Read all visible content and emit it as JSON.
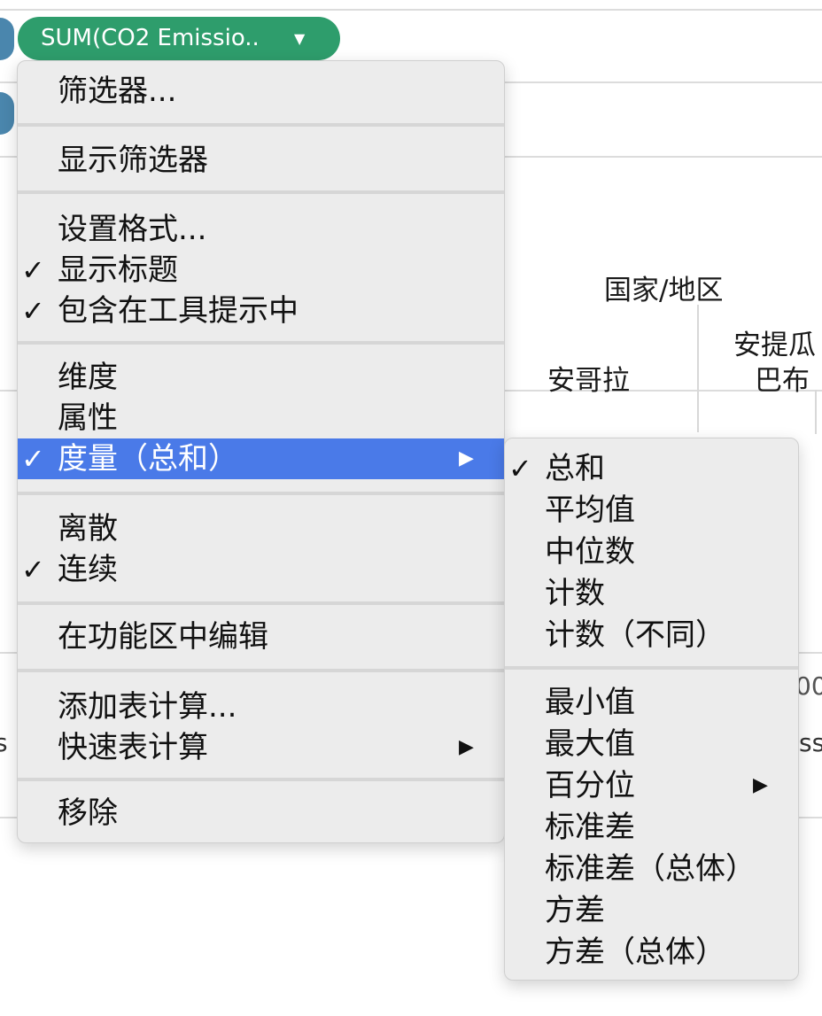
{
  "pill": {
    "label": "SUM(CO2 Emissio..",
    "caret": "▼",
    "color": "#2e9d6c"
  },
  "background": {
    "header_label": "国家/地区",
    "country_1": "安哥拉",
    "country_2_line1": "安提瓜",
    "country_2_line2": "巴布",
    "axis_fragment": "00",
    "row_fragment_left": "s p",
    "row_fragment_right": "ss"
  },
  "menu": {
    "items": [
      {
        "label": "筛选器...",
        "checked": false,
        "submenu": false
      },
      {
        "label": "显示筛选器",
        "checked": false,
        "submenu": false
      },
      {
        "label": "设置格式...",
        "checked": false,
        "submenu": false
      },
      {
        "label": "显示标题",
        "checked": true,
        "submenu": false
      },
      {
        "label": "包含在工具提示中",
        "checked": true,
        "submenu": false
      },
      {
        "label": "维度",
        "checked": false,
        "submenu": false
      },
      {
        "label": "属性",
        "checked": false,
        "submenu": false
      },
      {
        "label": "度量（总和）",
        "checked": true,
        "submenu": true,
        "highlighted": true
      },
      {
        "label": "离散",
        "checked": false,
        "submenu": false
      },
      {
        "label": "连续",
        "checked": true,
        "submenu": false
      },
      {
        "label": "在功能区中编辑",
        "checked": false,
        "submenu": false
      },
      {
        "label": "添加表计算...",
        "checked": false,
        "submenu": false
      },
      {
        "label": "快速表计算",
        "checked": false,
        "submenu": true
      },
      {
        "label": "移除",
        "checked": false,
        "submenu": false
      }
    ]
  },
  "submenu": {
    "items": [
      {
        "label": "总和",
        "checked": true,
        "submenu": false
      },
      {
        "label": "平均值",
        "checked": false,
        "submenu": false
      },
      {
        "label": "中位数",
        "checked": false,
        "submenu": false
      },
      {
        "label": "计数",
        "checked": false,
        "submenu": false
      },
      {
        "label": "计数（不同）",
        "checked": false,
        "submenu": false
      },
      {
        "label": "最小值",
        "checked": false,
        "submenu": false
      },
      {
        "label": "最大值",
        "checked": false,
        "submenu": false
      },
      {
        "label": "百分位",
        "checked": false,
        "submenu": true
      },
      {
        "label": "标准差",
        "checked": false,
        "submenu": false
      },
      {
        "label": "标准差（总体）",
        "checked": false,
        "submenu": false
      },
      {
        "label": "方差",
        "checked": false,
        "submenu": false
      },
      {
        "label": "方差（总体）",
        "checked": false,
        "submenu": false
      }
    ]
  },
  "symbols": {
    "check": "✓",
    "submenu_arrow": "▶"
  },
  "colors": {
    "highlight": "#4a7ae8",
    "menu_bg": "#ececec",
    "pill_green": "#2e9d6c",
    "shelf_blue": "#4a86ad"
  }
}
